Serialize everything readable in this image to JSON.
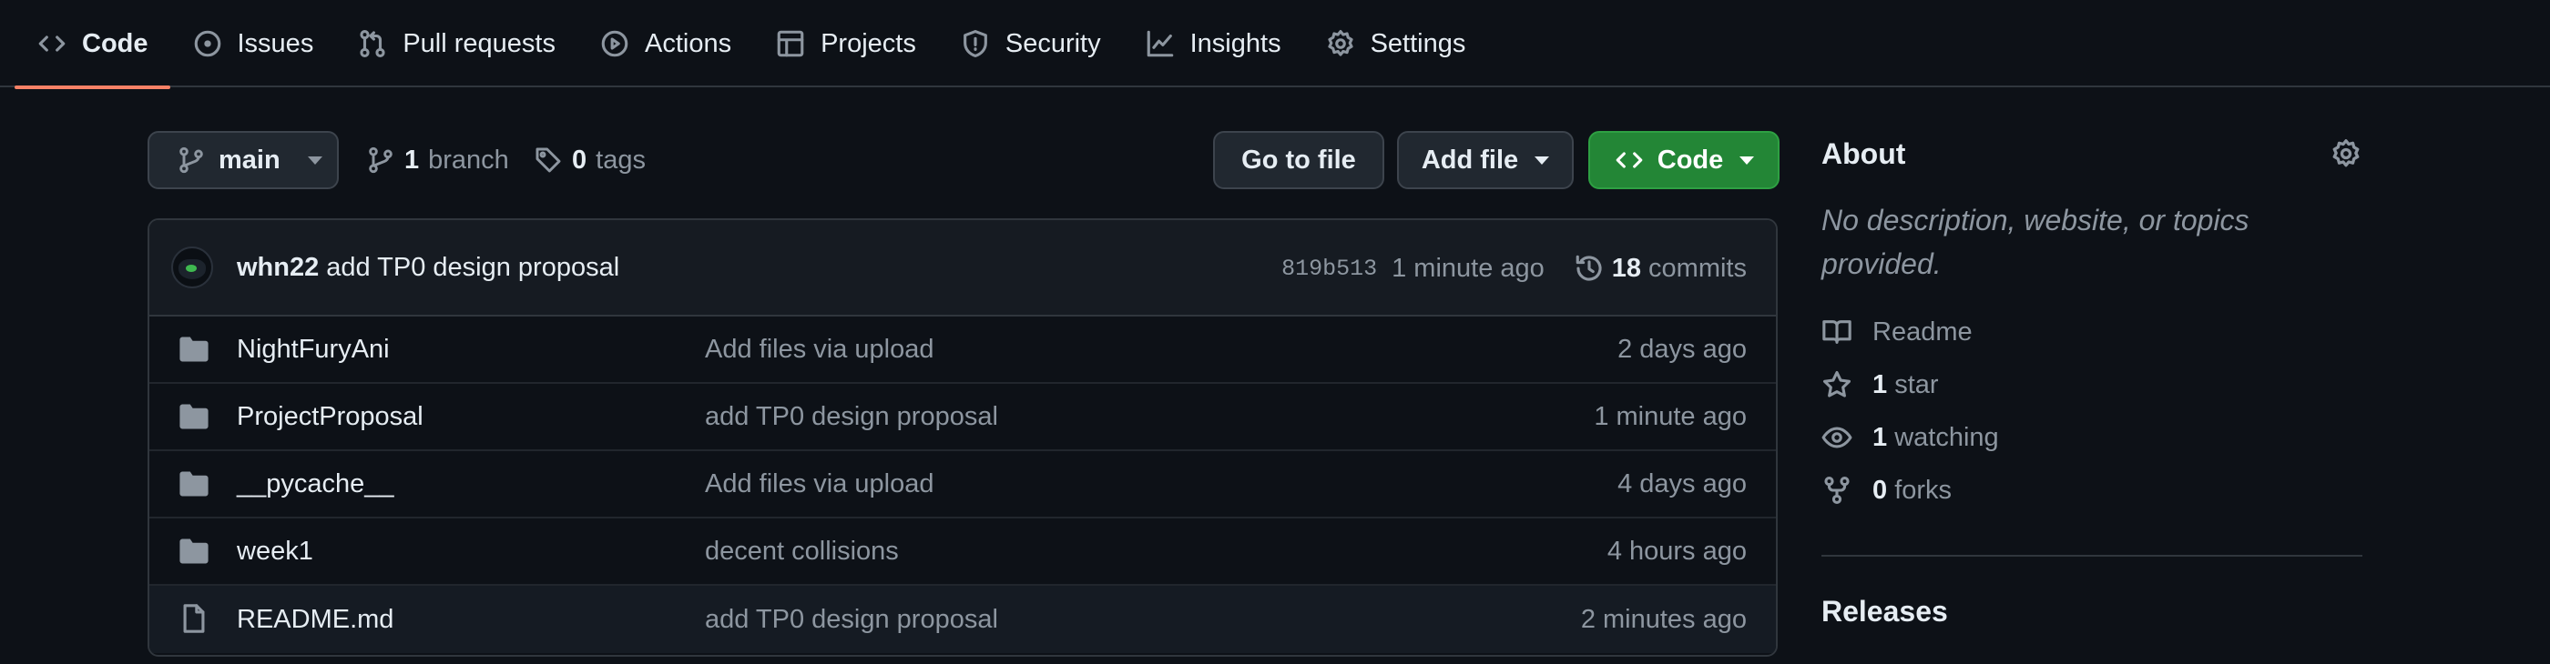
{
  "tabs": [
    {
      "label": "Code",
      "icon": "code-icon",
      "active": true
    },
    {
      "label": "Issues",
      "icon": "issue-icon"
    },
    {
      "label": "Pull requests",
      "icon": "pull-request-icon"
    },
    {
      "label": "Actions",
      "icon": "play-icon"
    },
    {
      "label": "Projects",
      "icon": "table-icon"
    },
    {
      "label": "Security",
      "icon": "shield-icon"
    },
    {
      "label": "Insights",
      "icon": "graph-icon"
    },
    {
      "label": "Settings",
      "icon": "gear-icon"
    }
  ],
  "branchbar": {
    "branch": "main",
    "branch_count": "1",
    "branch_word": "branch",
    "tag_count": "0",
    "tag_word": "tags",
    "go_to_file": "Go to file",
    "add_file": "Add file",
    "code": "Code"
  },
  "commit": {
    "author": "whn22",
    "message": "add TP0 design proposal",
    "sha": "819b513",
    "time": "1 minute ago",
    "count": "18",
    "count_word": "commits"
  },
  "files": [
    {
      "type": "folder",
      "name": "NightFuryAni",
      "message": "Add files via upload",
      "age": "2 days ago"
    },
    {
      "type": "folder",
      "name": "ProjectProposal",
      "message": "add TP0 design proposal",
      "age": "1 minute ago"
    },
    {
      "type": "folder",
      "name": "__pycache__",
      "message": "Add files via upload",
      "age": "4 days ago"
    },
    {
      "type": "folder",
      "name": "week1",
      "message": "decent collisions",
      "age": "4 hours ago"
    },
    {
      "type": "file",
      "name": "README.md",
      "message": "add TP0 design proposal",
      "age": "2 minutes ago"
    }
  ],
  "about": {
    "title": "About",
    "description": "No description, website, or topics provided.",
    "readme": "Readme",
    "stars_count": "1",
    "stars_word": "star",
    "watching_count": "1",
    "watching_word": "watching",
    "forks_count": "0",
    "forks_word": "forks",
    "releases_title": "Releases"
  },
  "colors": {
    "background": "#0d1117",
    "accent_tab_underline": "#f78166",
    "code_button": "#238636",
    "muted_text": "#8d96a0"
  }
}
